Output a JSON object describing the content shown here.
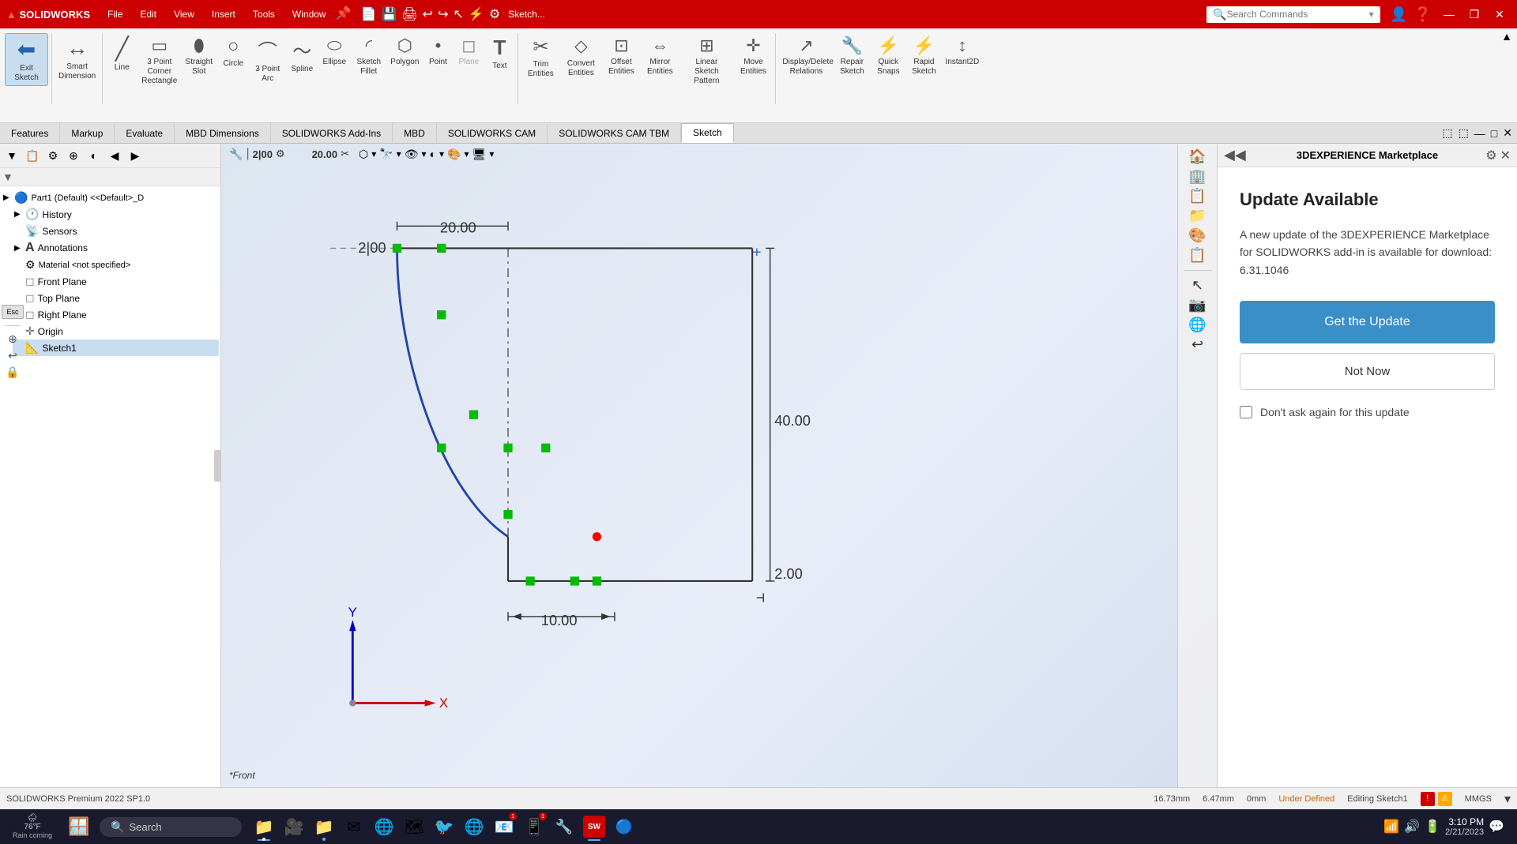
{
  "titlebar": {
    "logo": "DS SOLIDWORKS",
    "menus": [
      "File",
      "Edit",
      "View",
      "Insert",
      "Tools",
      "Window"
    ],
    "sketch_name": "Sketch...",
    "search_placeholder": "Search Commands",
    "window_controls": [
      "—",
      "❐",
      "✕"
    ]
  },
  "ribbon": {
    "active_tab": "Sketch",
    "tools": [
      {
        "id": "exit-sketch",
        "icon": "🚪",
        "label": "Exit\nSketch",
        "active": true
      },
      {
        "id": "smart-dimension",
        "icon": "↔",
        "label": "Smart\nDimension"
      },
      {
        "id": "line",
        "icon": "╱",
        "label": "Line"
      },
      {
        "id": "3pt-rectangle",
        "icon": "▭",
        "label": "3 Point\nCorner\nRectangle"
      },
      {
        "id": "straight-slot",
        "icon": "⬮",
        "label": "Straight\nSlot"
      },
      {
        "id": "circle",
        "icon": "○",
        "label": "Circle"
      },
      {
        "id": "3pt-arc",
        "icon": "⌒",
        "label": "3 Point\nArc"
      },
      {
        "id": "spline",
        "icon": "〜",
        "label": "Spline"
      },
      {
        "id": "ellipse",
        "icon": "⬭",
        "label": "Ellipse"
      },
      {
        "id": "sketch-fillet",
        "icon": "◜",
        "label": "Sketch\nFillet"
      },
      {
        "id": "polygon",
        "icon": "⬡",
        "label": "Polygon"
      },
      {
        "id": "point",
        "icon": "•",
        "label": "Point"
      },
      {
        "id": "plane",
        "icon": "◻",
        "label": "Plane"
      },
      {
        "id": "text",
        "icon": "T",
        "label": "Text"
      },
      {
        "id": "trim-entities",
        "icon": "✂",
        "label": "Trim\nEntities"
      },
      {
        "id": "convert-entities",
        "icon": "⬦",
        "label": "Convert\nEntities"
      },
      {
        "id": "offset-entities",
        "icon": "⊡",
        "label": "Offset\nEntities"
      },
      {
        "id": "mirror-entities",
        "icon": "⇔",
        "label": "Mirror\nEntities"
      },
      {
        "id": "linear-sketch-pattern",
        "icon": "⊞",
        "label": "Linear Sketch\nPattern"
      },
      {
        "id": "move-entities",
        "icon": "✛",
        "label": "Move\nEntities"
      },
      {
        "id": "display-delete-relations",
        "icon": "↗",
        "label": "Display/Delete\nRelations"
      },
      {
        "id": "repair-sketch",
        "icon": "🔧",
        "label": "Repair\nSketch"
      },
      {
        "id": "quick-snaps",
        "icon": "⚡",
        "label": "Quick\nSnaps"
      },
      {
        "id": "rapid-sketch",
        "icon": "⚡",
        "label": "Rapid\nSketch"
      },
      {
        "id": "instant2d",
        "icon": "↕",
        "label": "Instant2D"
      }
    ]
  },
  "tabbar": {
    "tabs": [
      "Features",
      "Markup",
      "Evaluate",
      "MBD Dimensions",
      "SOLIDWORKS Add-Ins",
      "MBD",
      "SOLIDWORKS CAM",
      "SOLIDWORKS CAM TBM",
      "Sketch"
    ]
  },
  "sidebar": {
    "root_label": "Part1 (Default) <<Default>_D",
    "items": [
      {
        "id": "history",
        "label": "History",
        "icon": "🕐",
        "expandable": true
      },
      {
        "id": "sensors",
        "label": "Sensors",
        "icon": "📡"
      },
      {
        "id": "annotations",
        "label": "Annotations",
        "icon": "A",
        "expandable": false
      },
      {
        "id": "material",
        "label": "Material <not specified>",
        "icon": "⚙"
      },
      {
        "id": "front-plane",
        "label": "Front Plane",
        "icon": "▭"
      },
      {
        "id": "top-plane",
        "label": "Top Plane",
        "icon": "▭"
      },
      {
        "id": "right-plane",
        "label": "Right Plane",
        "icon": "▭"
      },
      {
        "id": "origin",
        "label": "Origin",
        "icon": "✛"
      },
      {
        "id": "sketch1",
        "label": "Sketch1",
        "icon": "📐",
        "selected": true
      }
    ]
  },
  "canvas": {
    "dimensions": {
      "top_width": "20.00",
      "top_left": "2|00",
      "right_height": "40.00",
      "bottom_right": "2.00",
      "bottom_width": "10.00"
    },
    "view_label": "*Front"
  },
  "panel_3dx": {
    "title": "3DEXPERIENCE Marketplace",
    "update_title": "Update Available",
    "update_desc": "A new update of the 3DEXPERIENCE Marketplace for SOLIDWORKS add-in is available for download: 6.31.1046",
    "btn_update": "Get the Update",
    "btn_notnow": "Not Now",
    "checkbox_label": "Don't ask again for this update"
  },
  "statusbar": {
    "x": "16.73mm",
    "y": "6.47mm",
    "z": "0mm",
    "state": "Under Defined",
    "editing": "Editing Sketch1",
    "units": "MMGS",
    "sw_version": "SOLIDWORKS Premium 2022 SP1.0"
  },
  "taskbar": {
    "search_label": "Search",
    "time": "3:10 PM",
    "date": "2/21/2023",
    "weather": "76°F",
    "weather_desc": "Rain coming",
    "apps": [
      "🪟",
      "🔍",
      "📁",
      "🎥",
      "📁",
      "✉",
      "🔵",
      "🐦",
      "🌐",
      "✉",
      "📅",
      "🔵",
      "🔵",
      "SW",
      "🔵"
    ]
  }
}
